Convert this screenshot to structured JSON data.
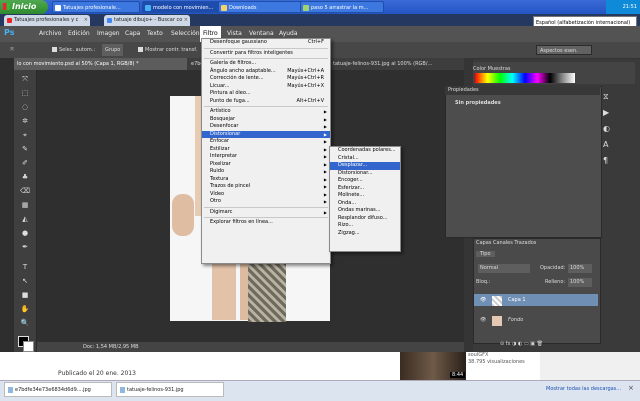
{
  "taskbar": {
    "start_label": "Inicio",
    "tasks": [
      {
        "label": "Tatuajes profesionale..."
      },
      {
        "label": "modelo con movimien..."
      },
      {
        "label": "Downloads"
      },
      {
        "label": "paso 5 arrastrar la m..."
      }
    ],
    "clock": "21:51"
  },
  "browser": {
    "tabs": [
      {
        "label": "Tatuajes profesionales y c",
        "close": "×"
      },
      {
        "label": "tatuaje dibujo+ - Buscar co",
        "close": "×"
      }
    ]
  },
  "language_indicator": "Español (alfabetización internacional)",
  "photoshop": {
    "logo": "Ps",
    "menubar": [
      "Archivo",
      "Edición",
      "Imagen",
      "Capa",
      "Texto",
      "Selección",
      "Filtro",
      "Vista",
      "Ventana",
      "Ayuda"
    ],
    "options": {
      "autoselect": "Selec. autom.:",
      "group": "Grupo",
      "show_transform": "Mostrar contr. transf.",
      "workspace": "Aspectos esen."
    },
    "doc_tabs": [
      "lo con movimiento.psd al 50% (Capa 1, RGB/8) *",
      "e7bdfe",
      "tatuaje-felinos-931.jpg al 100% (RGB/..."
    ],
    "tools": [
      "⤧",
      "⬚",
      "◌",
      "✲",
      "⌖",
      "✎",
      "✐",
      "♣",
      "⌫",
      "▦",
      "◭",
      "●",
      "✒",
      "T",
      "↖",
      "■",
      "✋",
      "🔍"
    ],
    "status": "Doc: 1,54 MB/2,95 MB"
  },
  "filter_menu": {
    "items": [
      {
        "label": "Desenfoque gaussiano",
        "shortcut": "Ctrl+F"
      },
      {
        "sep": true
      },
      {
        "label": "Convertir para filtros inteligentes"
      },
      {
        "sep": true
      },
      {
        "label": "Galería de filtros..."
      },
      {
        "label": "Ángulo ancho adaptable...",
        "shortcut": "Mayús+Ctrl+A"
      },
      {
        "label": "Corrección de lente...",
        "shortcut": "Mayús+Ctrl+R"
      },
      {
        "label": "Licuar...",
        "shortcut": "Mayús+Ctrl+X"
      },
      {
        "label": "Pintura al óleo..."
      },
      {
        "label": "Punto de fuga...",
        "shortcut": "Alt+Ctrl+V"
      },
      {
        "sep": true
      },
      {
        "label": "Artístico",
        "sub": true
      },
      {
        "label": "Bosquejar",
        "sub": true
      },
      {
        "label": "Desenfocar",
        "sub": true
      },
      {
        "label": "Distorsionar",
        "sub": true,
        "highlight": true
      },
      {
        "label": "Enfocar",
        "sub": true
      },
      {
        "label": "Estilizar",
        "sub": true
      },
      {
        "label": "Interpretar",
        "sub": true
      },
      {
        "label": "Pixelizar",
        "sub": true
      },
      {
        "label": "Ruido",
        "sub": true
      },
      {
        "label": "Textura",
        "sub": true
      },
      {
        "label": "Trazos de pincel",
        "sub": true
      },
      {
        "label": "Vídeo",
        "sub": true
      },
      {
        "label": "Otro",
        "sub": true
      },
      {
        "sep": true
      },
      {
        "label": "Digimarc",
        "sub": true
      },
      {
        "sep": true
      },
      {
        "label": "Explorar filtros en línea..."
      }
    ]
  },
  "distort_submenu": {
    "items": [
      {
        "label": "Coordenadas polares..."
      },
      {
        "label": "Cristal..."
      },
      {
        "label": "Desplazar...",
        "highlight": true
      },
      {
        "label": "Distorsionar..."
      },
      {
        "label": "Encoger..."
      },
      {
        "label": "Esferizar..."
      },
      {
        "label": "Molinete..."
      },
      {
        "label": "Onda..."
      },
      {
        "label": "Ondas marinas..."
      },
      {
        "label": "Resplandor difuso..."
      },
      {
        "label": "Rizo..."
      },
      {
        "label": "Zigzag..."
      }
    ]
  },
  "panels": {
    "color_tabs": "Color   Muestras",
    "properties": {
      "title": "Propiedades",
      "body": "Sin propiedades"
    },
    "layers": {
      "tabs": "Capas   Canales   Trazados",
      "kind": "Tipo",
      "blend": "Normal",
      "opacity_label": "Opacidad:",
      "opacity_value": "100%",
      "lock_label": "Bloq.:",
      "fill_label": "Relleno:",
      "fill_value": "100%",
      "rows": [
        {
          "name": "Capa 1",
          "selected": true
        },
        {
          "name": "Fondo",
          "italic": true
        }
      ],
      "bottom_icons": "⊝ fx ◑ ◐ ▭ ▣ 🗑"
    }
  },
  "webpage": {
    "published": "Publicado el 20 ene. 2013",
    "meta_lines": [
      "soulGFX",
      "38.795 visualizaciones"
    ],
    "duration": "8:44"
  },
  "downloads": {
    "items": [
      {
        "label": "e7bdfe34e73e6834d6d9....jpg"
      },
      {
        "label": "tatuaje-felinos-931.jpg"
      }
    ],
    "show_all": "Mostrar todas las descargas...",
    "close": "×"
  }
}
